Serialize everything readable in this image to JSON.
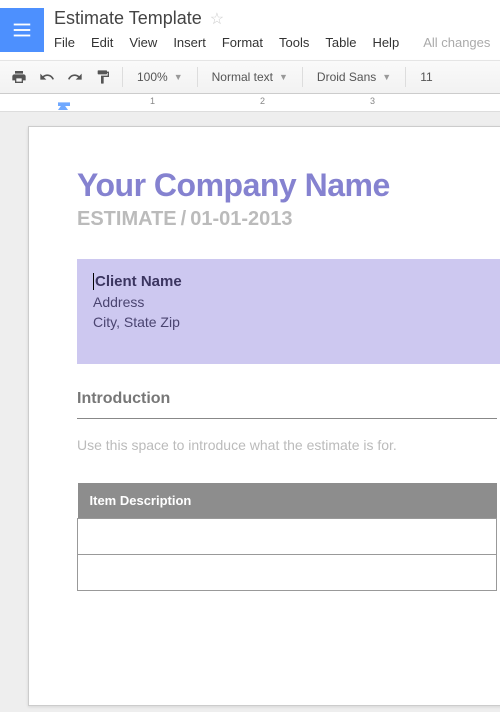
{
  "header": {
    "doc_title": "Estimate Template",
    "saved_status": "All changes"
  },
  "menu": {
    "file": "File",
    "edit": "Edit",
    "view": "View",
    "insert": "Insert",
    "format": "Format",
    "tools": "Tools",
    "table": "Table",
    "help": "Help"
  },
  "toolbar": {
    "zoom": "100%",
    "style": "Normal text",
    "font": "Droid Sans",
    "size": "11"
  },
  "ruler": {
    "n1": "1",
    "n2": "2",
    "n3": "3"
  },
  "doc": {
    "company": "Your Company Name",
    "estimate_label": "ESTIMATE",
    "slash": "/",
    "estimate_date": "01-01-2013",
    "client_name": "Client Name",
    "client_addr": "Address",
    "client_city": "City, State Zip",
    "intro_heading": "Introduction",
    "intro_body": "Use this space to introduce what the estimate is for.",
    "table_header": "Item Description"
  }
}
